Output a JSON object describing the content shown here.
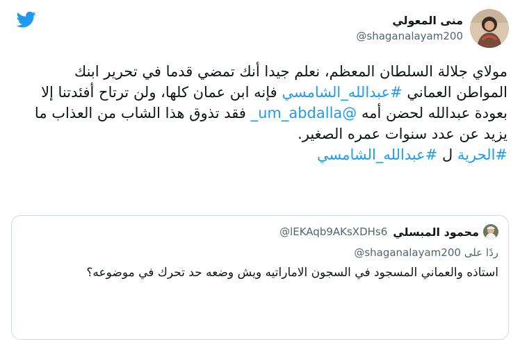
{
  "tweet": {
    "display_name": "منى المعولي",
    "handle": "@shaganalayam200",
    "text_parts": {
      "p1": "مولاي جلالة السلطان المعظم، نعلم جيدا أنك تمضي قدما في تحرير ابنك المواطن العماني ",
      "hashtag1": "#عبدالله_الشامسي",
      "p2": " فإنه ابن عمان كلها، ولن ترتاح أفئدتنا إلا بعودة عبدالله لحضن أمه ",
      "mention": "@um_abdalla_",
      "p3": " فقد تذوق هذا الشاب من العذاب ما يزيد عن عدد سنوات عمره الصغير.",
      "hashtag2": "#الحرية",
      "p4": " ل ",
      "hashtag3": "#عبدالله_الشامسي"
    }
  },
  "quoted": {
    "display_name": "محمود المبسلي",
    "handle": "@lEKAqb9AKsXDHs6",
    "reply_prefix": "ردًا على",
    "reply_to": "@shaganalayam200",
    "text": "استاذه والعماني المسجود في السجون الاماراتيه ويش وضعه حد تحرك في موضوعه؟"
  },
  "colors": {
    "brand": "#1d9bf0",
    "link": "#1d9bf0",
    "border": "#cfd9de",
    "muted": "#536471"
  },
  "icons": {
    "logo": "twitter-bird-icon"
  }
}
